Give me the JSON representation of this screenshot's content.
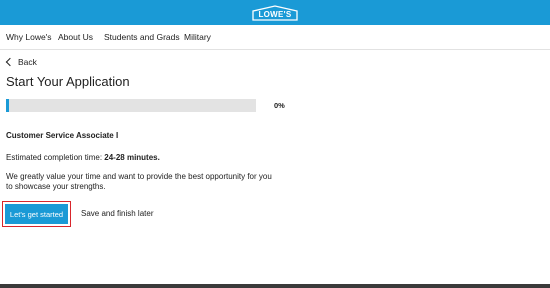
{
  "brand": {
    "logo_text": "LOWE'S",
    "color": "#1a9ad6"
  },
  "nav": {
    "items": [
      {
        "label": "Why Lowe's"
      },
      {
        "label": "About Us"
      },
      {
        "label": "Students and Grads"
      },
      {
        "label": "Military"
      }
    ]
  },
  "back": {
    "label": "Back",
    "icon": "chevron-left-icon"
  },
  "page": {
    "title": "Start Your Application"
  },
  "progress": {
    "percent": 0,
    "label": "0%"
  },
  "job": {
    "title": "Customer Service Associate I"
  },
  "estimate": {
    "prefix": "Estimated completion time: ",
    "value": "24-28 minutes."
  },
  "message": {
    "text": "We greatly value your time and want to provide the best opportunity for you to showcase your strengths."
  },
  "actions": {
    "start_label": "Let's get started",
    "later_label": "Save and finish later"
  },
  "colors": {
    "accent": "#1a9ad6",
    "highlight": "#d8262c"
  }
}
